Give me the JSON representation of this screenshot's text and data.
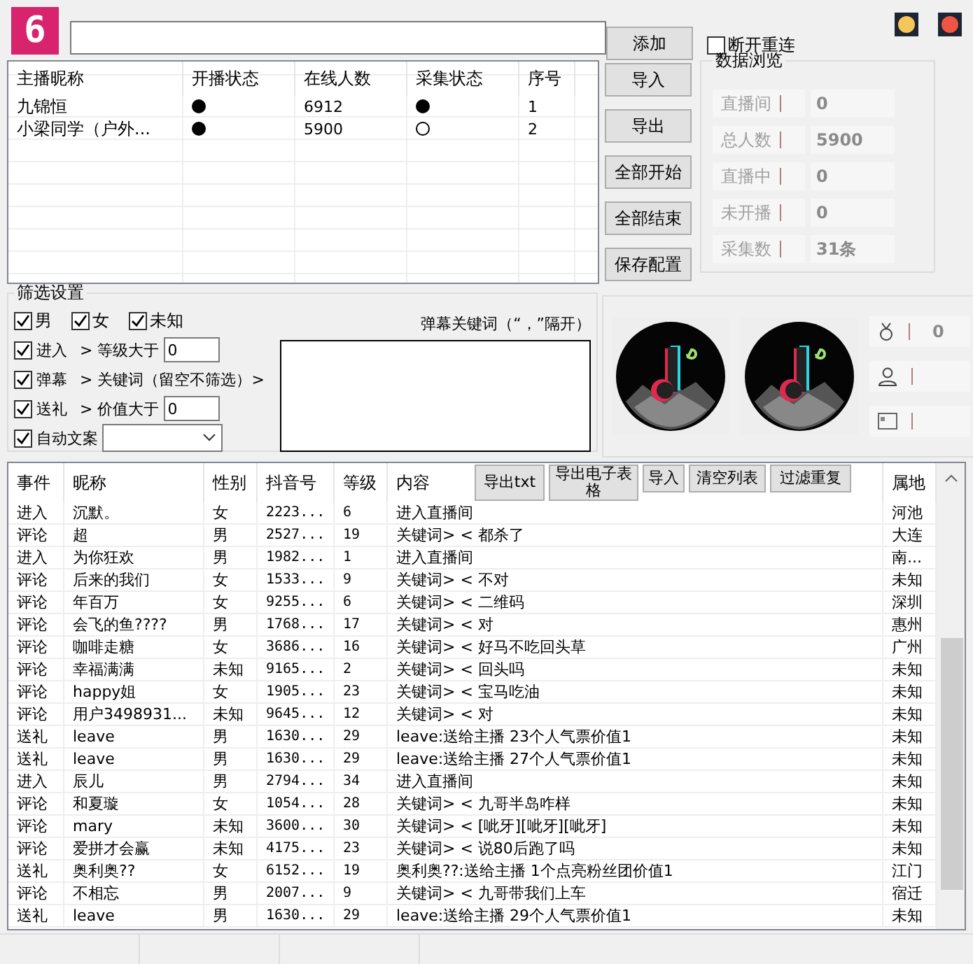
{
  "logo": {
    "text": "6"
  },
  "add_button": "添加",
  "reconnect": {
    "label": "断开重连",
    "checked": false
  },
  "streamers": {
    "columns": [
      "主播昵称",
      "开播状态",
      "在线人数",
      "采集状态",
      "序号"
    ],
    "rows": [
      {
        "name": "九锦恒",
        "live": true,
        "online": "6912",
        "collecting": true,
        "index": "1"
      },
      {
        "name": "小梁同学（户外...",
        "live": true,
        "online": "5900",
        "collecting": false,
        "index": "2"
      }
    ]
  },
  "actions": [
    "导入",
    "导出",
    "全部开始",
    "全部结束",
    "保存配置"
  ],
  "stats": {
    "title": "数据浏览",
    "items": [
      {
        "label": "直播间",
        "value": "0"
      },
      {
        "label": "总人数",
        "value": "5900"
      },
      {
        "label": "直播中",
        "value": "0"
      },
      {
        "label": "未开播",
        "value": "0"
      },
      {
        "label": "采集数",
        "value": "31条"
      }
    ]
  },
  "filter": {
    "title": "筛选设置",
    "genders": [
      {
        "label": "男",
        "checked": true
      },
      {
        "label": "女",
        "checked": true
      },
      {
        "label": "未知",
        "checked": true
      }
    ],
    "rules": [
      {
        "kind": "number",
        "label": "进入",
        "checked": true,
        "condition": "> 等级大于",
        "value": "0"
      },
      {
        "kind": "text",
        "label": "弹幕",
        "checked": true,
        "condition": "> 关键词（留空不筛选）>"
      },
      {
        "kind": "number",
        "label": "送礼",
        "checked": true,
        "condition": "> 价值大于",
        "value": "0"
      },
      {
        "kind": "select",
        "label": "自动文案",
        "checked": true
      }
    ],
    "keywords_label": "弹幕关键词（“，”隔开）"
  },
  "counters": [
    {
      "kind": "medal",
      "value": "0"
    },
    {
      "kind": "user"
    },
    {
      "kind": "card"
    }
  ],
  "events": {
    "columns": [
      "事件",
      "昵称",
      "性别",
      "抖音号",
      "等级",
      "内容",
      "属地"
    ],
    "toolbar": [
      "导出txt",
      "导出电子表格",
      "导入",
      "清空列表",
      "过滤重复"
    ],
    "rows": [
      {
        "event": "进入",
        "nick": "沉默。",
        "gender": "女",
        "id": "2223...",
        "grade": "6",
        "content": "进入直播间",
        "region": "河池"
      },
      {
        "event": "评论",
        "nick": "超",
        "gender": "男",
        "id": "2527...",
        "grade": "19",
        "content": "关键词> < 都杀了",
        "region": "大连"
      },
      {
        "event": "进入",
        "nick": "为你狂欢",
        "gender": "男",
        "id": "1982...",
        "grade": "1",
        "content": "进入直播间",
        "region": "南..."
      },
      {
        "event": "评论",
        "nick": "后来的我们",
        "gender": "女",
        "id": "1533...",
        "grade": "9",
        "content": "关键词> < 不对",
        "region": "未知"
      },
      {
        "event": "评论",
        "nick": "年百万",
        "gender": "女",
        "id": "9255...",
        "grade": "6",
        "content": "关键词> < 二维码",
        "region": "深圳"
      },
      {
        "event": "评论",
        "nick": "会飞的鱼????",
        "gender": "男",
        "id": "1768...",
        "grade": "17",
        "content": "关键词> < 对",
        "region": "惠州"
      },
      {
        "event": "评论",
        "nick": "咖啡走糖",
        "gender": "女",
        "id": "3686...",
        "grade": "16",
        "content": "关键词> < 好马不吃回头草",
        "region": "广州"
      },
      {
        "event": "评论",
        "nick": "幸福满满",
        "gender": "未知",
        "id": "9165...",
        "grade": "2",
        "content": "关键词> < 回头吗",
        "region": "未知"
      },
      {
        "event": "评论",
        "nick": "happy姐",
        "gender": "女",
        "id": "1905...",
        "grade": "23",
        "content": "关键词> < 宝马吃油",
        "region": "未知"
      },
      {
        "event": "评论",
        "nick": "用户3498931...",
        "gender": "未知",
        "id": "9645...",
        "grade": "12",
        "content": "关键词> < 对",
        "region": "未知"
      },
      {
        "event": "送礼",
        "nick": "leave",
        "gender": "男",
        "id": "1630...",
        "grade": "29",
        "content": "leave:送给主播 23个人气票价值1",
        "region": "未知"
      },
      {
        "event": "送礼",
        "nick": "leave",
        "gender": "男",
        "id": "1630...",
        "grade": "29",
        "content": "leave:送给主播 27个人气票价值1",
        "region": "未知"
      },
      {
        "event": "进入",
        "nick": "辰儿",
        "gender": "男",
        "id": "2794...",
        "grade": "34",
        "content": "进入直播间",
        "region": "未知"
      },
      {
        "event": "评论",
        "nick": "和夏璇",
        "gender": "女",
        "id": "1054...",
        "grade": "28",
        "content": "关键词> < 九哥半岛咋样",
        "region": "未知"
      },
      {
        "event": "评论",
        "nick": "mary",
        "gender": "未知",
        "id": "3600...",
        "grade": "30",
        "content": "关键词> < [呲牙][呲牙][呲牙]",
        "region": "未知"
      },
      {
        "event": "评论",
        "nick": "爱拼才会赢",
        "gender": "未知",
        "id": "4175...",
        "grade": "23",
        "content": "关键词> < 说80后跑了吗",
        "region": "未知"
      },
      {
        "event": "送礼",
        "nick": "奥利奥??",
        "gender": "女",
        "id": "6152...",
        "grade": "19",
        "content": "奥利奥??:送给主播 1个点亮粉丝团价值1",
        "region": "江门"
      },
      {
        "event": "评论",
        "nick": "不相忘",
        "gender": "男",
        "id": "2007...",
        "grade": "9",
        "content": "关键词> < 九哥带我们上车",
        "region": "宿迁"
      },
      {
        "event": "送礼",
        "nick": "leave",
        "gender": "男",
        "id": "1630...",
        "grade": "29",
        "content": "leave:送给主播 29个人气票价值1",
        "region": "未知"
      }
    ]
  }
}
